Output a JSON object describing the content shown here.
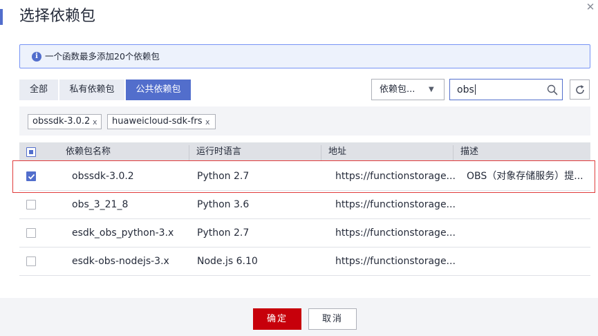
{
  "dialog": {
    "title": "选择依赖包",
    "close_icon": "close-icon"
  },
  "info": {
    "icon": "info-icon",
    "icon_glyph": "i",
    "text": "一个函数最多添加20个依赖包"
  },
  "tabs": [
    {
      "label": "全部",
      "active": false
    },
    {
      "label": "私有依赖包",
      "active": false
    },
    {
      "label": "公共依赖包",
      "active": true
    }
  ],
  "filter": {
    "select_value": "依赖包...",
    "search_value": "obs"
  },
  "selected_chips": [
    {
      "label": "obssdk-3.0.2",
      "remove": "x"
    },
    {
      "label": "huaweicloud-sdk-frs",
      "remove": "x"
    }
  ],
  "table": {
    "columns": [
      "依赖包名称",
      "运行时语言",
      "地址",
      "描述"
    ],
    "rows": [
      {
        "checked": true,
        "name": "obssdk-3.0.2",
        "runtime": "Python 2.7",
        "address": "https://functionstorage...",
        "description": "OBS（对象存储服务）提..."
      },
      {
        "checked": false,
        "name": "obs_3_21_8",
        "runtime": "Python 3.6",
        "address": "https://functionstorage...",
        "description": ""
      },
      {
        "checked": false,
        "name": "esdk_obs_python-3.x",
        "runtime": "Python 2.7",
        "address": "https://functionstorage...",
        "description": ""
      },
      {
        "checked": false,
        "name": "esdk-obs-nodejs-3.x",
        "runtime": "Node.js 6.10",
        "address": "https://functionstorage...",
        "description": ""
      }
    ]
  },
  "footer": {
    "ok_label": "确定",
    "cancel_label": "取消"
  },
  "colors": {
    "primary": "#526ecc",
    "danger": "#c7000b",
    "highlight": "#e03a3a"
  }
}
